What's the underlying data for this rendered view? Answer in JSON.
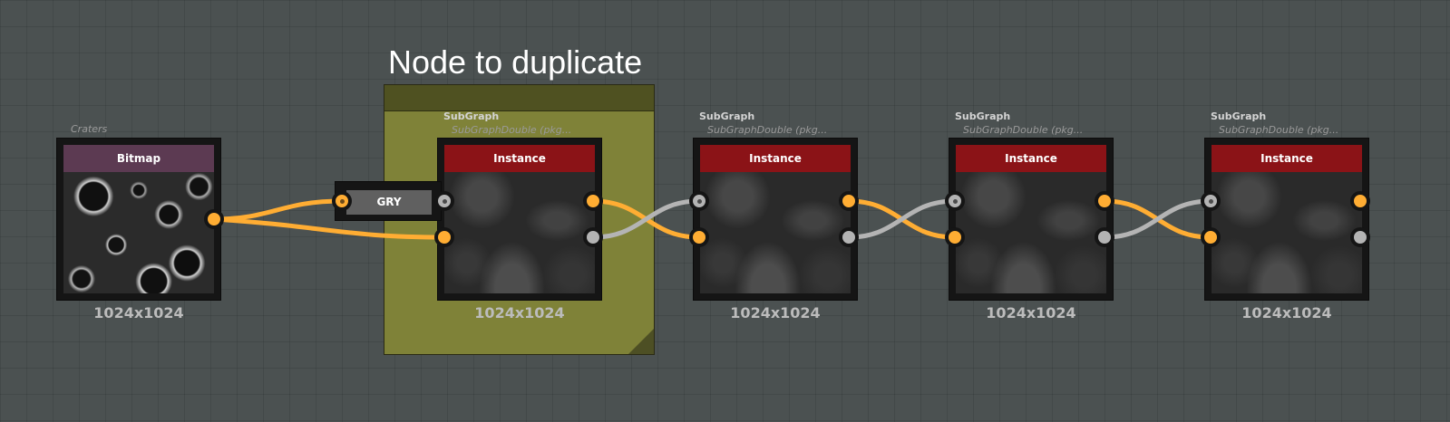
{
  "frame": {
    "title": "Node to duplicate",
    "color": "#7f8238",
    "header_color": "#4f5121"
  },
  "colors": {
    "background": "#4b5151",
    "wire_orange": "#ffad33",
    "wire_gray": "#b4b4b4",
    "instance_header": "#8b1317",
    "bitmap_header": "#5c3a52"
  },
  "nodes": [
    {
      "id": "craters",
      "label": "Craters",
      "sublabel": "",
      "header": "Bitmap",
      "resolution": "1024x1024"
    },
    {
      "id": "instance1",
      "label": "SubGraph",
      "sublabel": "SubGraphDouble (pkg...",
      "header": "Instance",
      "resolution": "1024x1024"
    },
    {
      "id": "instance2",
      "label": "SubGraph",
      "sublabel": "SubGraphDouble (pkg...",
      "header": "Instance",
      "resolution": "1024x1024"
    },
    {
      "id": "instance3",
      "label": "SubGraph",
      "sublabel": "SubGraphDouble (pkg...",
      "header": "Instance",
      "resolution": "1024x1024"
    },
    {
      "id": "instance4",
      "label": "SubGraph",
      "sublabel": "SubGraphDouble (pkg...",
      "header": "Instance",
      "resolution": "1024x1024"
    }
  ],
  "converter": {
    "label": "GRY"
  }
}
